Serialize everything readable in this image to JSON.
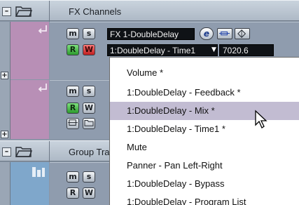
{
  "folders": [
    {
      "label": "FX Channels"
    },
    {
      "label": "Group Tracks"
    }
  ],
  "fx_track": {
    "mute": "m",
    "solo": "s",
    "read": "R",
    "write": "W",
    "name": "FX 1-DoubleDelay",
    "edit": "e",
    "parameter": "1:DoubleDelay - Time1",
    "value": "7020.6"
  },
  "track2": {
    "mute": "m",
    "solo": "s",
    "read": "R",
    "write": "W"
  },
  "group_track": {
    "mute": "m",
    "solo": "s",
    "read": "R",
    "write": "W"
  },
  "menu": {
    "items": [
      "Volume *",
      "1:DoubleDelay - Feedback *",
      "1:DoubleDelay - Mix *",
      "1:DoubleDelay - Time1 *",
      "Mute",
      "Panner - Pan Left-Right",
      "1:DoubleDelay - Bypass",
      "1:DoubleDelay - Program List"
    ],
    "highlighted_index": 2
  },
  "colors": {
    "fx_strip": "#b88fb6",
    "group_strip": "#7fa7cb",
    "highlight": "#c2bcd2"
  }
}
